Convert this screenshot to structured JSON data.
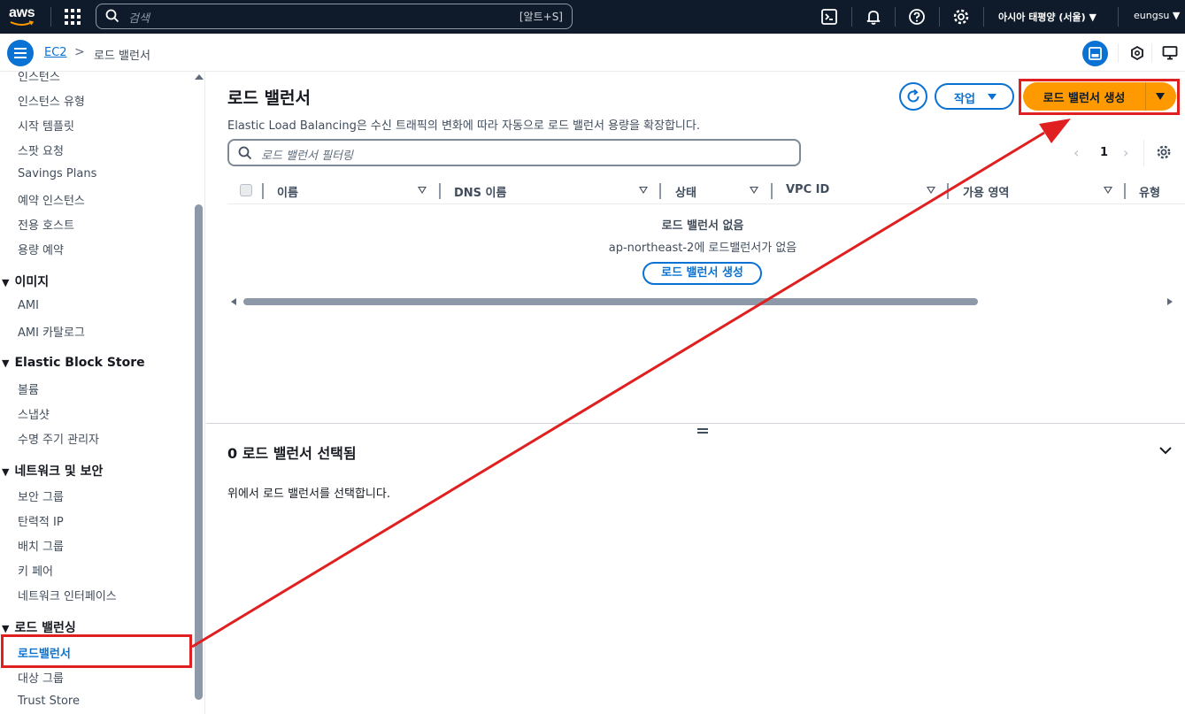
{
  "topnav": {
    "logo": "aws",
    "search_placeholder": "검색",
    "search_shortcut": "[알트+S]",
    "region": "아시아 태평양 (서울) ▼",
    "user": "eungsu ▼",
    "icons": [
      "services-grid-icon",
      "search-icon",
      "cloudshell-icon",
      "bell-icon",
      "help-icon",
      "gear-icon"
    ]
  },
  "breadcrumb": {
    "root": "EC2",
    "separator": ">",
    "current": "로드 밸런서"
  },
  "sidebar": {
    "items_top": [
      "인스턴스",
      "인스턴스 유형",
      "시작 템플릿",
      "스팟 요청",
      "Savings Plans",
      "예약 인스턴스",
      "전용 호스트",
      "용량 예약"
    ],
    "sections": [
      {
        "title": "이미지",
        "items": [
          "AMI",
          "AMI 카탈로그"
        ]
      },
      {
        "title": "Elastic Block Store",
        "items": [
          "볼륨",
          "스냅샷",
          "수명 주기 관리자"
        ]
      },
      {
        "title": "네트워크 및 보안",
        "items": [
          "보안 그룹",
          "탄력적 IP",
          "배치 그룹",
          "키 페어",
          "네트워크 인터페이스"
        ]
      },
      {
        "title": "로드 밸런싱",
        "items": [
          "로드밸런서",
          "대상 그룹",
          "Trust Store"
        ]
      }
    ],
    "active_item": "로드밸런서"
  },
  "main": {
    "title": "로드 밸런서",
    "description": "Elastic Load Balancing은 수신 트래픽의 변화에 따라 자동으로 로드 밸런서 용량을 확장합니다.",
    "actions_label": "작업",
    "create_label": "로드 밸런서 생성",
    "filter_placeholder": "로드 밸런서 필터링",
    "page_number": "1",
    "columns": [
      "이름",
      "DNS 이름",
      "상태",
      "VPC ID",
      "가용 영역",
      "유형"
    ],
    "empty_title": "로드 밸런서 없음",
    "empty_sub": "ap-northeast-2에 로드밸런서가 없음",
    "empty_create_label": "로드 밸런서 생성",
    "detail_title": "0 로드 밸런서 선택됨",
    "detail_text": "위에서 로드 밸런서를 선택합니다."
  },
  "colors": {
    "nav_bg": "#0f1b2a",
    "link_blue": "#0972d3",
    "primary_orange": "#ff9900",
    "annotation_red": "#e02020"
  }
}
